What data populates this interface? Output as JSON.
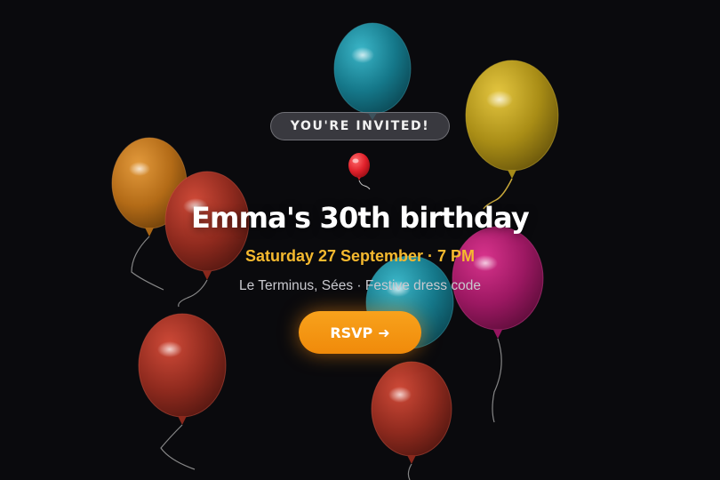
{
  "invite": {
    "badge": "YOU'RE INVITED!",
    "title": "Emma's 30th birthday",
    "date_time": "Saturday 27 September · 7 PM",
    "details": "Le Terminus, Sées · Festive dress code",
    "rsvp_label": "RSVP",
    "rsvp_arrow": "➜"
  },
  "colors": {
    "background": "#0a0a0d",
    "accent": "#f5b92f",
    "button": "#f39312"
  }
}
